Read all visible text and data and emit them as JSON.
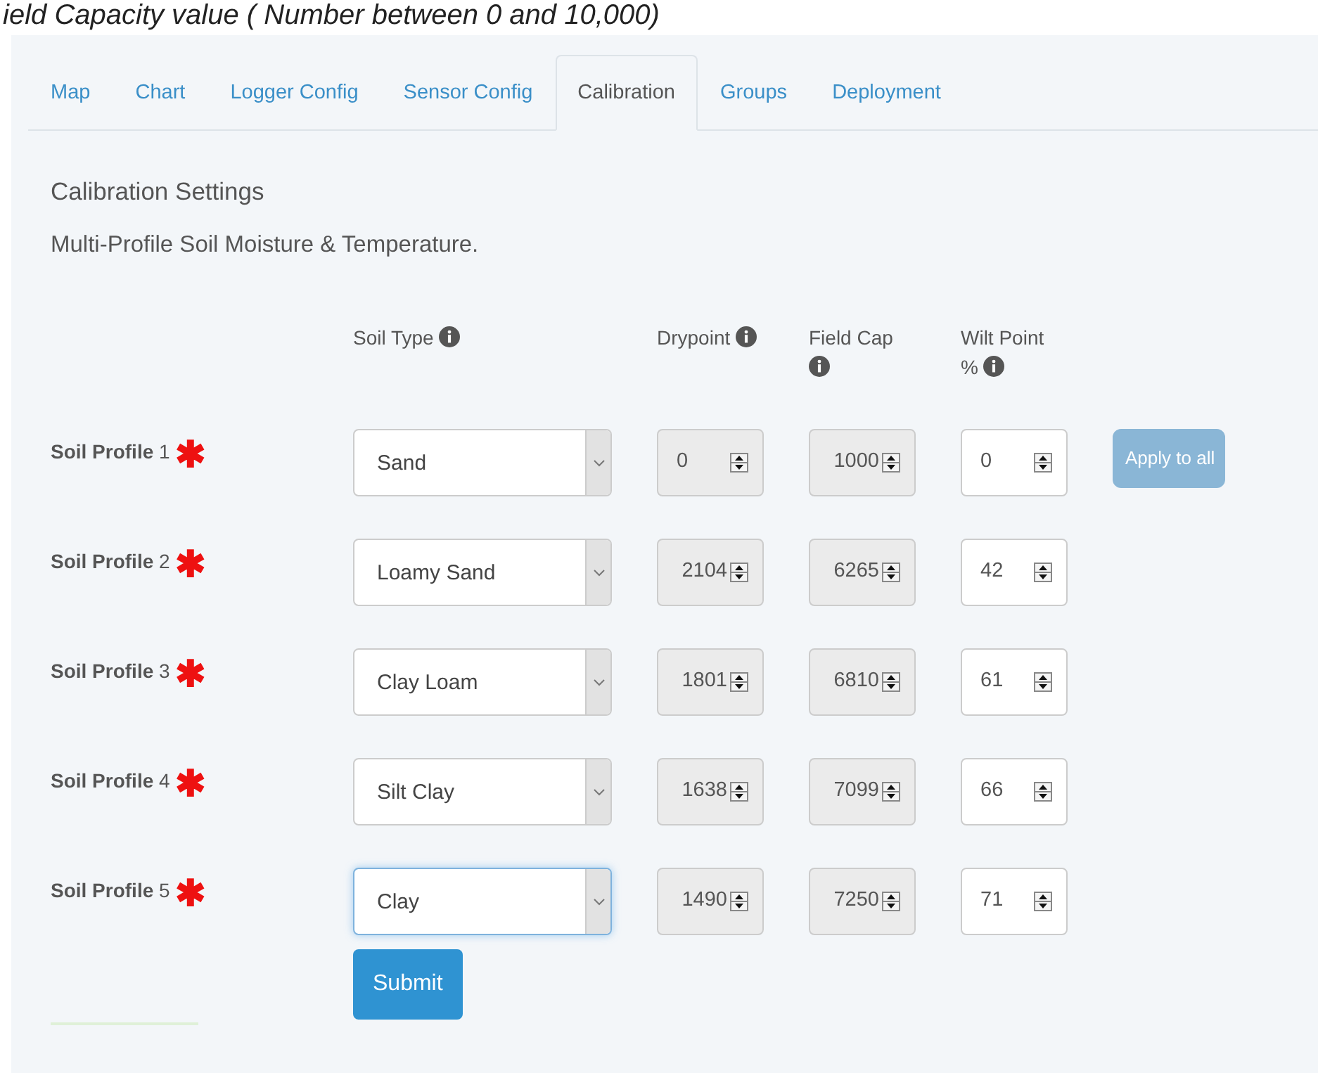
{
  "header_text": "ield Capacity value ( Number between 0 and 10,000)",
  "tabs": [
    {
      "label": "Map",
      "selected": false
    },
    {
      "label": "Chart",
      "selected": false
    },
    {
      "label": "Logger Config",
      "selected": false
    },
    {
      "label": "Sensor Config",
      "selected": false
    },
    {
      "label": "Calibration",
      "selected": true
    },
    {
      "label": "Groups",
      "selected": false
    },
    {
      "label": "Deployment",
      "selected": false
    }
  ],
  "title": "Calibration Settings",
  "subtitle": "Multi-Profile Soil Moisture & Temperature.",
  "columns": [
    {
      "label": "Soil Type",
      "info": true
    },
    {
      "label": "Drypoint",
      "info": true
    },
    {
      "label": "Field Cap",
      "info": true
    },
    {
      "label": "Wilt Point",
      "unit": "%",
      "info": true
    }
  ],
  "profiles": [
    {
      "label": "**Soil Profile** 1",
      "required_mark": "✱",
      "soil_type": {
        "value": "Sand",
        "focused": false
      },
      "drypoint": {
        "value": "0",
        "disabled": true
      },
      "field_cap": {
        "value": "1000",
        "disabled": true
      },
      "wilt_point": {
        "value": "0",
        "disabled": false
      }
    },
    {
      "label": "**Soil Profile** 2",
      "required_mark": "✱",
      "soil_type": {
        "value": "Loamy Sand",
        "focused": false
      },
      "drypoint": {
        "value": "2104",
        "disabled": true
      },
      "field_cap": {
        "value": "6265",
        "disabled": true
      },
      "wilt_point": {
        "value": "42",
        "disabled": false
      }
    },
    {
      "label": "**Soil Profile** 3",
      "required_mark": "✱",
      "soil_type": {
        "value": "Clay Loam",
        "focused": false
      },
      "drypoint": {
        "value": "1801",
        "disabled": true
      },
      "field_cap": {
        "value": "6810",
        "disabled": true
      },
      "wilt_point": {
        "value": "61",
        "disabled": false
      }
    },
    {
      "label": "**Soil Profile** 4",
      "required_mark": "✱",
      "soil_type": {
        "value": "Silt Clay",
        "focused": false
      },
      "drypoint": {
        "value": "1638",
        "disabled": true
      },
      "field_cap": {
        "value": "7099",
        "disabled": true
      },
      "wilt_point": {
        "value": "66",
        "disabled": false
      }
    },
    {
      "label": "**Soil Profile** 5",
      "required_mark": "✱",
      "soil_type": {
        "value": "Clay",
        "focused": true
      },
      "drypoint": {
        "value": "1490",
        "disabled": true
      },
      "field_cap": {
        "value": "7250",
        "disabled": true
      },
      "wilt_point": {
        "value": "71",
        "disabled": false
      }
    }
  ],
  "apply_button": {
    "label": "Apply to all",
    "disabled": true
  },
  "submit_button": {
    "label": "Submit"
  }
}
